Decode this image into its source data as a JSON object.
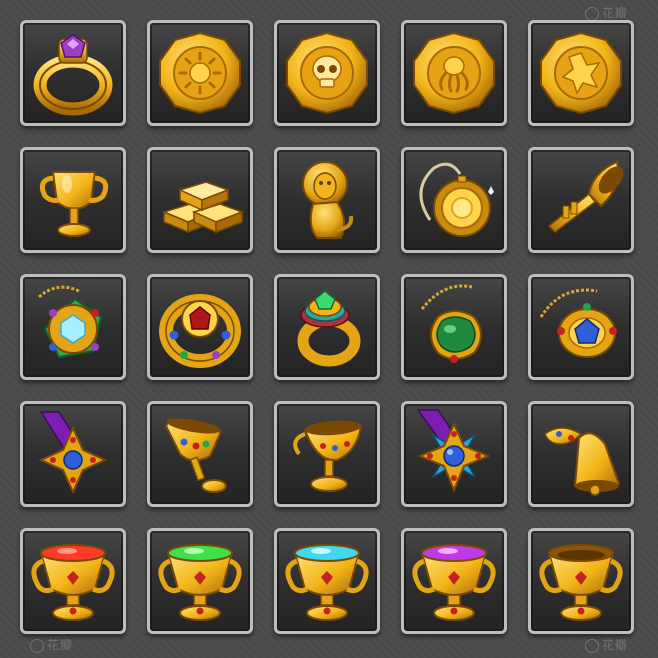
{
  "watermark": {
    "text": "花瓣"
  },
  "inventory": {
    "rows": [
      [
        {
          "item": "gold-ring-purple-gem"
        },
        {
          "item": "gold-coin-sun"
        },
        {
          "item": "gold-coin-skull"
        },
        {
          "item": "gold-coin-octopus"
        },
        {
          "item": "gold-coin-leaf"
        }
      ],
      [
        {
          "item": "gold-trophy-cup"
        },
        {
          "item": "gold-bars"
        },
        {
          "item": "gold-lion-statue"
        },
        {
          "item": "gold-pocket-watch"
        },
        {
          "item": "gold-trumpet"
        }
      ],
      [
        {
          "item": "jeweled-brooch-pendant"
        },
        {
          "item": "jeweled-gold-ring"
        },
        {
          "item": "emerald-gold-ring"
        },
        {
          "item": "emerald-pendant"
        },
        {
          "item": "sapphire-gold-pendant"
        }
      ],
      [
        {
          "item": "gold-cross-medal"
        },
        {
          "item": "jeweled-gold-goblet"
        },
        {
          "item": "gold-chalice"
        },
        {
          "item": "gold-star-medal"
        },
        {
          "item": "gold-bell"
        }
      ],
      [
        {
          "item": "trophy-goblet-red"
        },
        {
          "item": "trophy-goblet-green"
        },
        {
          "item": "trophy-goblet-cyan"
        },
        {
          "item": "trophy-goblet-purple"
        },
        {
          "item": "trophy-goblet-empty"
        }
      ]
    ]
  },
  "colors": {
    "gold_light": "#ffe27a",
    "gold": "#f2b418",
    "gold_dark": "#a86a08",
    "ruby": "#c8221c",
    "sapphire": "#2f5fd6",
    "emerald": "#20a848",
    "amethyst": "#9b3fc9",
    "potion_red": "#ff3a28",
    "potion_green": "#3fe04a",
    "potion_cyan": "#3fd8f0",
    "potion_purple": "#c13ae8"
  }
}
